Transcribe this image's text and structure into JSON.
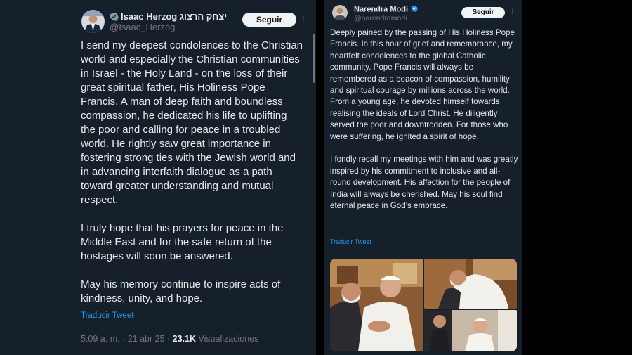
{
  "left_tweet": {
    "author_name": "Isaac Herzog יצחק הרצוג",
    "author_handle": "@Isaac_Herzog",
    "follow_label": "Seguir",
    "paragraphs": [
      "I send my deepest condolences to the Christian world and especially the Christian communities in Israel - the Holy Land - on the loss of their great spiritual father, His Holiness Pope Francis. A man of deep faith and boundless compassion, he dedicated his life to uplifting the poor and calling for peace in a troubled world. He rightly saw great importance in fostering strong ties with the Jewish world and in advancing interfaith dialogue as a path toward greater understanding and mutual respect.",
      "I truly hope that his prayers for peace in the Middle East and for the safe return of the hostages will soon be answered.",
      "May his memory continue to inspire acts of kindness, unity, and hope."
    ],
    "translate_label": "Traducir Tweet",
    "timestamp": "5:09 a. m. · 21 abr 25 · ",
    "views_count": "23.1K",
    "views_label": " Visualizaciones"
  },
  "right_tweet": {
    "author_name": "Narendra Modi",
    "author_handle": "@narendramodi",
    "follow_label": "Seguir",
    "paragraphs": [
      "Deeply pained by the passing of His Holiness Pope Francis. In this hour of grief and remembrance, my heartfelt condolences to the global Catholic community. Pope Francis will always be remembered as a beacon of compassion, humility and spiritual courage by millions across the world. From a young age, he devoted himself towards realising the ideals of Lord Christ. He diligently served the poor and downtrodden. For those who were suffering, he ignited a spirit of hope.",
      "I fondly recall my meetings with him and was greatly inspired by his commitment to inclusive and all-round development. His affection for the people of India will always be cherished. May his soul find eternal peace in God’s embrace."
    ],
    "translate_label": "Traducir Tweet"
  },
  "colors": {
    "background": "#16202b",
    "text": "#e7e9ea",
    "muted": "#71767b",
    "link": "#1d9bf0",
    "button_bg": "#eff3f4"
  },
  "icons": [
    "verified-badge-icon",
    "more-options-icon"
  ]
}
